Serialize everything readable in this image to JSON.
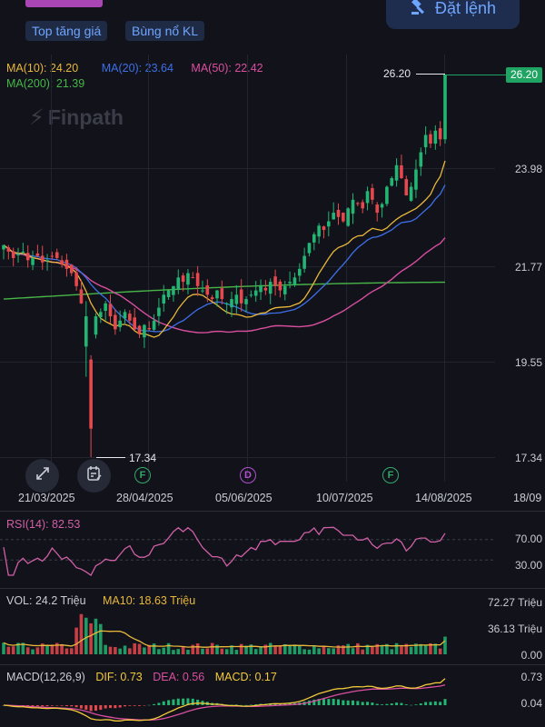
{
  "header": {
    "tags": [
      "Top tăng giá",
      "Bùng nổ KL"
    ],
    "order_button": "Đặt lệnh"
  },
  "watermark": "Finpath",
  "ma_legend": {
    "ma10": "MA(10): 24.20",
    "ma20": "MA(20): 23.64",
    "ma50": "MA(50): 22.42",
    "ma200": "MA(200): 21.39"
  },
  "colors": {
    "up": "#22b573",
    "down": "#e5484d",
    "ma10": "#e8b73b",
    "ma20": "#3d6fe8",
    "ma50": "#d94ea0",
    "ma200": "#47b548",
    "rsi": "#d05fa7",
    "macd_dif": "#f2c93b",
    "macd_dea": "#d94ea0",
    "accent": "#6ea6ff",
    "event_f": "#2faa6b",
    "event_d": "#b14fcf"
  },
  "price_axis": [
    "26.20",
    "23.98",
    "21.77",
    "19.55",
    "17.34"
  ],
  "last_price_tag": "26.20",
  "high_label": "26.20",
  "low_label": "17.34",
  "date_axis": [
    "21/03/2025",
    "28/04/2025",
    "05/06/2025",
    "10/07/2025",
    "14/08/2025",
    "18/09"
  ],
  "events": [
    "F",
    "D",
    "F"
  ],
  "toolbar_icons": [
    "expand-icon",
    "calendar-edit-icon"
  ],
  "rsi": {
    "label": "RSI(14): 82.53",
    "axis": [
      "70.00",
      "30.00"
    ]
  },
  "volume": {
    "label": "VOL: 24.2 Triệu",
    "ma_label": "MA10: 18.63 Triệu",
    "axis": [
      "72.27 Triệu",
      "36.13 Triệu",
      "0.00"
    ]
  },
  "macd": {
    "label": "MACD(12,26,9)",
    "dif": "DIF: 0.73",
    "dea": "DEA: 0.56",
    "macd": "MACD: 0.17",
    "axis": [
      "0.73",
      "0.04"
    ]
  },
  "chart_data": {
    "type": "candlestick",
    "y_range": [
      17.34,
      26.2
    ],
    "closes": [
      22.25,
      22.1,
      21.95,
      22.05,
      22.1,
      21.9,
      21.95,
      22.0,
      21.85,
      21.9,
      22.0,
      21.95,
      21.8,
      21.7,
      21.6,
      21.3,
      20.9,
      20.6,
      20.2,
      20.6,
      20.7,
      20.9,
      20.6,
      20.3,
      20.5,
      20.7,
      20.5,
      20.3,
      20.2,
      20.4,
      20.3,
      20.5,
      20.8,
      21.1,
      21.2,
      21.3,
      21.5,
      21.4,
      21.6,
      21.5,
      21.3,
      21.2,
      21.1,
      21.0,
      21.2,
      21.0,
      20.9,
      21.0,
      21.1,
      20.9,
      21.0,
      21.1,
      21.2,
      21.3,
      21.2,
      21.4,
      21.3,
      21.2,
      21.3,
      21.4,
      21.5,
      21.7,
      22.0,
      22.3,
      22.5,
      22.7,
      22.6,
      22.8,
      23.0,
      22.9,
      22.8,
      23.1,
      23.3,
      23.2,
      23.1,
      23.5,
      23.3,
      23.0,
      23.2,
      23.6,
      23.8,
      24.1,
      23.8,
      23.4,
      23.6,
      24.0,
      24.4,
      24.8,
      24.6,
      24.9,
      24.7,
      26.2
    ],
    "ma10_end": 24.2,
    "ma20_end": 23.64,
    "ma50_end": 22.42,
    "ma200_end": 21.39,
    "high": 26.2,
    "low": 17.34,
    "rsi_last": 82.53,
    "volume_last_million": 24.2,
    "volume_ma10_million": 18.63,
    "macd_dif_last": 0.73,
    "macd_dea_last": 0.56,
    "macd_hist_last": 0.17
  }
}
